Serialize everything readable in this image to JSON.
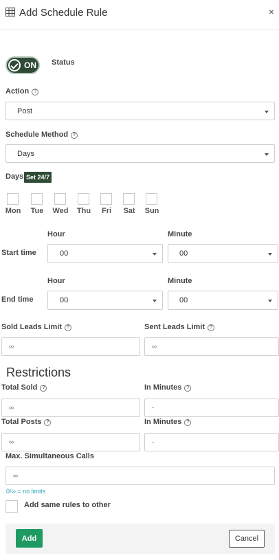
{
  "header": {
    "title": "Add Schedule Rule",
    "close_glyph": "×"
  },
  "status": {
    "toggle_label": "ON",
    "label": "Status",
    "checked": true
  },
  "action": {
    "label": "Action",
    "value": "Post"
  },
  "schedule_method": {
    "label": "Schedule Method",
    "value": "Days"
  },
  "days": {
    "label": "Days",
    "badge": "Set 24/7",
    "items": [
      "Mon",
      "Tue",
      "Wed",
      "Thu",
      "Fri",
      "Sat",
      "Sun"
    ]
  },
  "start_time": {
    "label": "Start time",
    "hour_label": "Hour",
    "minute_label": "Minute",
    "hour": "00",
    "minute": "00"
  },
  "end_time": {
    "label": "End time",
    "hour_label": "Hour",
    "minute_label": "Minute",
    "hour": "00",
    "minute": "00"
  },
  "limits": {
    "sold_label": "Sold Leads Limit",
    "sold_value": "∞",
    "sent_label": "Sent Leads Limit",
    "sent_value": "∞"
  },
  "restrictions": {
    "title": "Restrictions",
    "total_sold_label": "Total Sold",
    "total_sold_value": "∞",
    "minutes1_label": "In Minutes",
    "minutes1_value": "-",
    "total_posts_label": "Total Posts",
    "total_posts_value": "∞",
    "minutes2_label": "In Minutes",
    "minutes2_value": "-",
    "max_calls_label": "Max. Simultaneous Calls",
    "max_calls_value": "∞",
    "hint": "0/∞ = no limits"
  },
  "same_rules": {
    "label": "Add same rules to other"
  },
  "footer": {
    "add": "Add",
    "cancel": "Cancel"
  },
  "colors": {
    "accent": "#2f4a35",
    "primary_button": "#1f9a63",
    "hint": "#2b9fb8"
  }
}
